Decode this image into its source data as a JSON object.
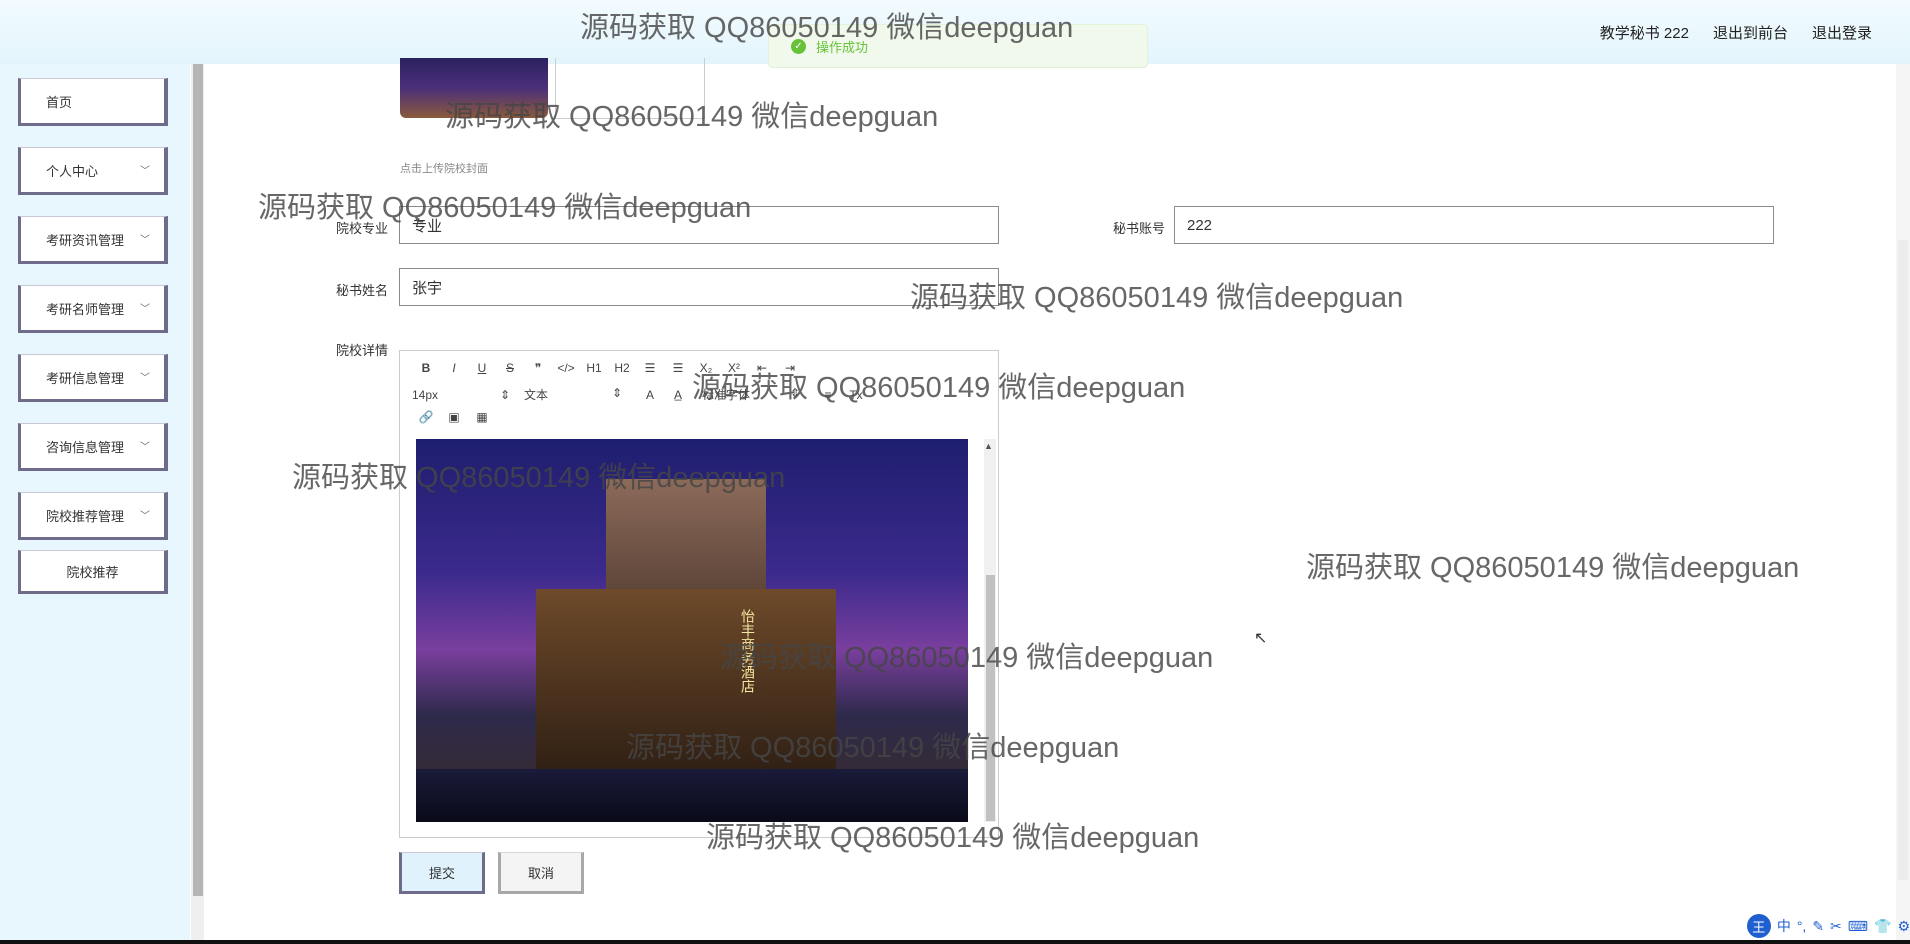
{
  "header": {
    "links": [
      "教学秘书 222",
      "退出到前台",
      "退出登录"
    ]
  },
  "toast": {
    "message": "操作成功"
  },
  "sidebar": {
    "items": [
      {
        "label": "首页",
        "has_chevron": false
      },
      {
        "label": "个人中心",
        "has_chevron": true
      },
      {
        "label": "考研资讯管理",
        "has_chevron": true
      },
      {
        "label": "考研名师管理",
        "has_chevron": true
      },
      {
        "label": "考研信息管理",
        "has_chevron": true
      },
      {
        "label": "咨询信息管理",
        "has_chevron": true
      },
      {
        "label": "院校推荐管理",
        "has_chevron": true
      },
      {
        "label": "院校推荐",
        "has_chevron": false
      }
    ]
  },
  "form": {
    "cover_hint": "点击上传院校封面",
    "major_label": "院校专业",
    "major_value": "专业",
    "account_label": "秘书账号",
    "account_value": "222",
    "name_label": "秘书姓名",
    "name_value": "张宇",
    "detail_label": "院校详情"
  },
  "editor": {
    "toolbar_row1": [
      "B",
      "I",
      "U",
      "S",
      "❞",
      "</>",
      "H1",
      "H2",
      "☰",
      "☰",
      "X₂",
      "X²",
      "⇤",
      "⇥"
    ],
    "font_size": "14px",
    "block_type": "文本",
    "font_family": "标准字体",
    "toolbar_row2_icons": [
      "A",
      "A̲",
      "≡",
      "Tx"
    ],
    "toolbar_row3": [
      "🔗",
      "▣",
      "▦"
    ],
    "image_sign": "怡丰商务酒店"
  },
  "buttons": {
    "submit": "提交",
    "cancel": "取消"
  },
  "watermark": "源码获取 QQ86050149 微信deepguan",
  "ime": {
    "logo": "王",
    "items": [
      "中",
      "°,",
      "✎",
      "✂",
      "⌨",
      "👕",
      "⚙"
    ]
  },
  "colors": {
    "menu_border": "#6f6b8a",
    "success": "#67c23a",
    "header_bg": "#e3f5fc"
  }
}
